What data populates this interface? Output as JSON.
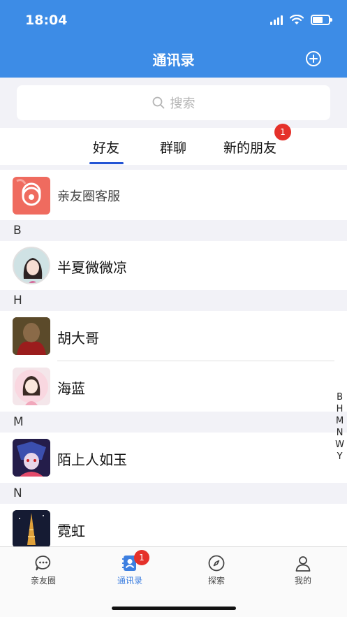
{
  "status": {
    "time": "18:04"
  },
  "header": {
    "title": "通讯录"
  },
  "search": {
    "placeholder": "搜索"
  },
  "tabs": [
    {
      "label": "好友",
      "active": true
    },
    {
      "label": "群聊"
    },
    {
      "label": "新的朋友",
      "badge": "1"
    }
  ],
  "service": {
    "name": "亲友圈客服"
  },
  "sections": [
    {
      "letter": "B",
      "contacts": [
        "半夏微微凉"
      ]
    },
    {
      "letter": "H",
      "contacts": [
        "胡大哥",
        "海蓝"
      ]
    },
    {
      "letter": "M",
      "contacts": [
        "陌上人如玉"
      ]
    },
    {
      "letter": "N",
      "contacts": [
        "霓虹"
      ]
    }
  ],
  "index_letters": [
    "B",
    "H",
    "M",
    "N",
    "W",
    "Y"
  ],
  "tabbar": [
    {
      "label": "亲友圈",
      "icon": "chat-bubble-icon"
    },
    {
      "label": "通讯录",
      "icon": "contacts-icon",
      "active": true,
      "badge": "1"
    },
    {
      "label": "探索",
      "icon": "compass-icon"
    },
    {
      "label": "我的",
      "icon": "person-icon"
    }
  ],
  "colors": {
    "accent": "#3d8ce6",
    "badge": "#e5312a",
    "active_tab": "#2354d4"
  }
}
